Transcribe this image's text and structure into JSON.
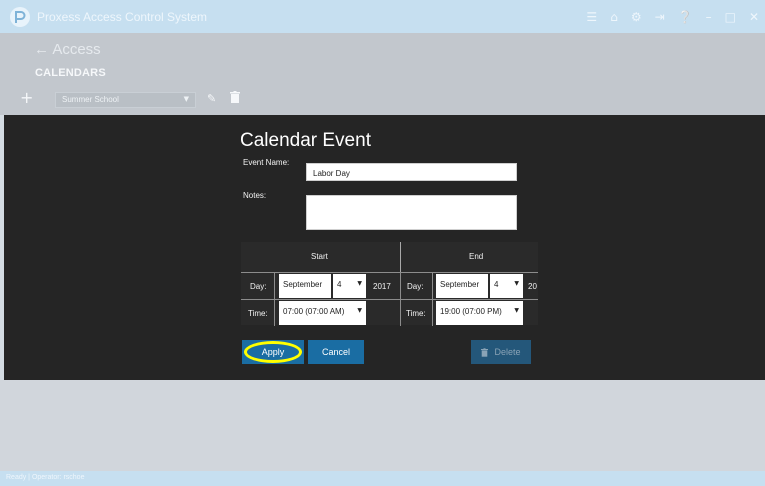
{
  "app": {
    "title": "Proxess Access Control System",
    "accent_color": "#1a6da3",
    "titlebar_color": "#c6dff0"
  },
  "titlebar": {
    "icons": [
      "menu-icon",
      "home-icon",
      "settings-icon",
      "logout-icon",
      "help-icon",
      "minimize-icon",
      "maximize-icon",
      "close-icon"
    ]
  },
  "page": {
    "back_label": "← Access",
    "section_title": "CALENDARS",
    "add_symbol": "+",
    "calendar_selected": "Summer School"
  },
  "modal": {
    "title": "Calendar Event",
    "event_name_label": "Event Name:",
    "event_name_value": "Labor Day",
    "notes_label": "Notes:",
    "notes_value": "",
    "start": {
      "header": "Start",
      "day_label": "Day:",
      "month": "September",
      "day": "4",
      "year": "2017",
      "time_label": "Time:",
      "time": "07:00 (07:00 AM)"
    },
    "end": {
      "header": "End",
      "day_label": "Day:",
      "month": "September",
      "day": "4",
      "year": "20",
      "time_label": "Time:",
      "time": "19:00 (07:00 PM)"
    },
    "apply_label": "Apply",
    "cancel_label": "Cancel",
    "delete_label": "Delete"
  },
  "status": {
    "text": "Ready | Operator: rschoe"
  }
}
